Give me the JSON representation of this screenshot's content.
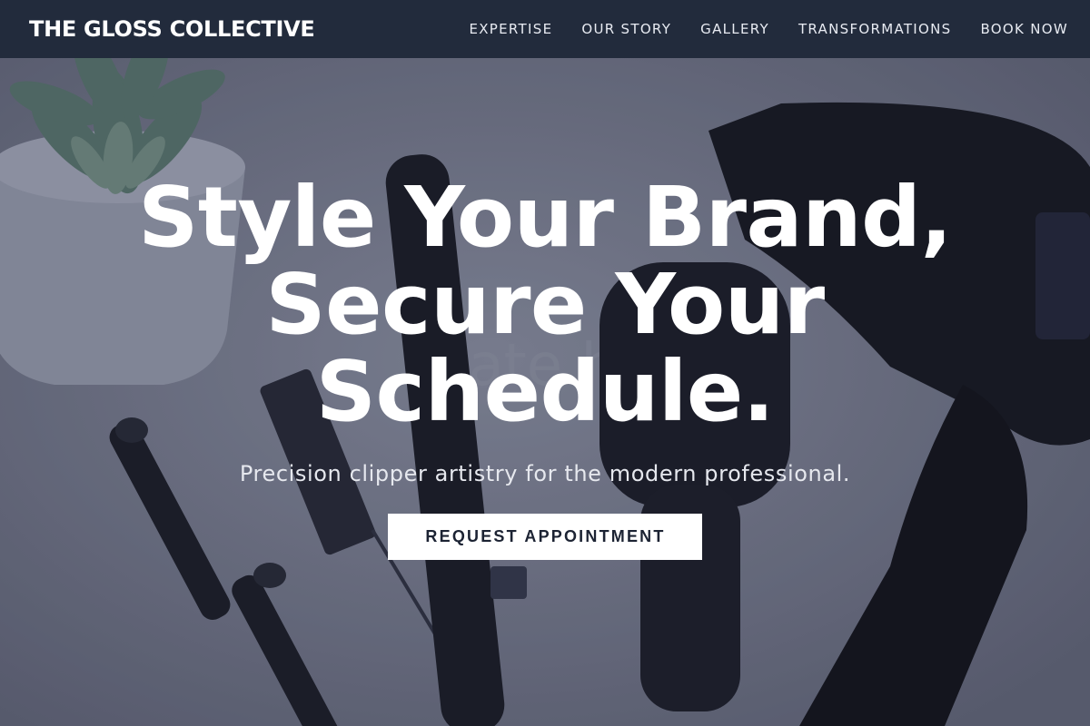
{
  "header": {
    "brand": "THE GLOSS COLLECTIVE",
    "nav": [
      {
        "label": "EXPERTISE"
      },
      {
        "label": "OUR STORY"
      },
      {
        "label": "GALLERY"
      },
      {
        "label": "TRANSFORMATIONS"
      },
      {
        "label": "BOOK NOW"
      }
    ]
  },
  "hero": {
    "headline_lines": [
      "Style Your Brand,",
      "Secure Your",
      "Schedule."
    ],
    "subheadline": "Precision clipper artistry for the modern professional.",
    "cta_label": "REQUEST APPOINTMENT",
    "background_image": "salon-tools-photo",
    "background_text": "...late hair"
  },
  "colors": {
    "nav_bg": "#222b3c",
    "overlay": "#1e2234",
    "cta_bg": "#ffffff",
    "cta_text": "#1c2333"
  },
  "icons": [
    "succulent-plant",
    "hair-clip",
    "tail-comb",
    "hair-straightener",
    "paddle-brush",
    "hair-dryer"
  ]
}
